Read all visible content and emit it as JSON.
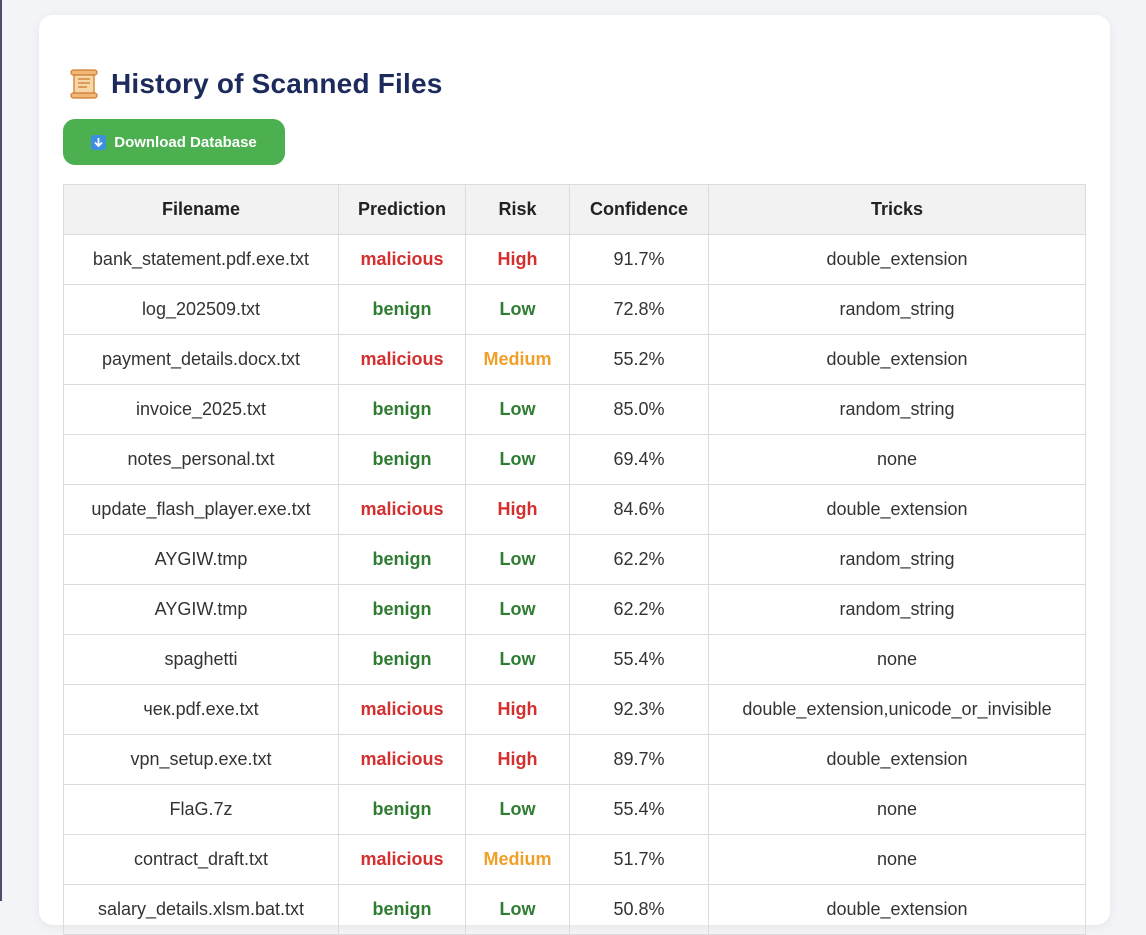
{
  "header": {
    "icon": "scroll-icon",
    "title": "History of Scanned Files"
  },
  "toolbar": {
    "download_icon": "download-arrow-icon",
    "download_label": "Download Database"
  },
  "colors": {
    "title": "#1c2b5c",
    "button_bg": "#4caf50",
    "malicious": "#d32f2f",
    "benign": "#2e7d32",
    "high": "#d32f2f",
    "low": "#2e7d32",
    "medium": "#f0a02a"
  },
  "table": {
    "columns": [
      "Filename",
      "Prediction",
      "Risk",
      "Confidence",
      "Tricks"
    ],
    "rows": [
      {
        "filename": "bank_statement.pdf.exe.txt",
        "prediction": "malicious",
        "risk": "High",
        "confidence": "91.7%",
        "tricks": "double_extension"
      },
      {
        "filename": "log_202509.txt",
        "prediction": "benign",
        "risk": "Low",
        "confidence": "72.8%",
        "tricks": "random_string"
      },
      {
        "filename": "payment_details.docx.txt",
        "prediction": "malicious",
        "risk": "Medium",
        "confidence": "55.2%",
        "tricks": "double_extension"
      },
      {
        "filename": "invoice_2025.txt",
        "prediction": "benign",
        "risk": "Low",
        "confidence": "85.0%",
        "tricks": "random_string"
      },
      {
        "filename": "notes_personal.txt",
        "prediction": "benign",
        "risk": "Low",
        "confidence": "69.4%",
        "tricks": "none"
      },
      {
        "filename": "update_flash_player.exe.txt",
        "prediction": "malicious",
        "risk": "High",
        "confidence": "84.6%",
        "tricks": "double_extension"
      },
      {
        "filename": "AYGIW.tmp",
        "prediction": "benign",
        "risk": "Low",
        "confidence": "62.2%",
        "tricks": "random_string"
      },
      {
        "filename": "AYGIW.tmp",
        "prediction": "benign",
        "risk": "Low",
        "confidence": "62.2%",
        "tricks": "random_string"
      },
      {
        "filename": "spaghetti",
        "prediction": "benign",
        "risk": "Low",
        "confidence": "55.4%",
        "tricks": "none"
      },
      {
        "filename": "чек.pdf.exe.txt",
        "prediction": "malicious",
        "risk": "High",
        "confidence": "92.3%",
        "tricks": "double_extension,unicode_or_invisible"
      },
      {
        "filename": "vpn_setup.exe.txt",
        "prediction": "malicious",
        "risk": "High",
        "confidence": "89.7%",
        "tricks": "double_extension"
      },
      {
        "filename": "FlaG.7z",
        "prediction": "benign",
        "risk": "Low",
        "confidence": "55.4%",
        "tricks": "none"
      },
      {
        "filename": "contract_draft.txt",
        "prediction": "malicious",
        "risk": "Medium",
        "confidence": "51.7%",
        "tricks": "none"
      },
      {
        "filename": "salary_details.xlsm.bat.txt",
        "prediction": "benign",
        "risk": "Low",
        "confidence": "50.8%",
        "tricks": "double_extension"
      }
    ]
  }
}
